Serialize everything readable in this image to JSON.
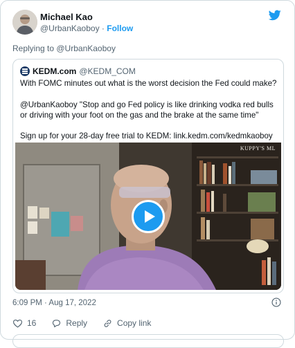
{
  "author": {
    "name": "Michael Kao",
    "handle": "@UrbanKaoboy",
    "separator": "·",
    "follow_label": "Follow"
  },
  "reply": {
    "prefix": "Replying to ",
    "mention": "@UrbanKaoboy"
  },
  "quote": {
    "name": "KEDM.com",
    "handle": "@KEDM_COM",
    "paragraphs": [
      "With FOMC minutes out what is the worst decision the Fed could make?",
      "@UrbanKaoboy \"Stop and go Fed policy is like drinking vodka red bulls or driving with your foot on the gas and the brake at the same time\"",
      "Sign up for your 28-day free trial to KEDM: link.kedm.com/kedmkaoboy"
    ],
    "video_watermark": "KUPPY'S ML"
  },
  "timestamp": "6:09 PM · Aug 17, 2022",
  "actions": {
    "like_count": "16",
    "reply_label": "Reply",
    "copy_link_label": "Copy link"
  },
  "colors": {
    "accent": "#1d9bf0",
    "muted_text": "#536471",
    "border": "#cfd9de"
  },
  "icons": [
    "twitter-bird-icon",
    "info-icon",
    "heart-icon",
    "reply-bubble-icon",
    "link-icon",
    "play-icon",
    "kedm-logo-icon"
  ]
}
